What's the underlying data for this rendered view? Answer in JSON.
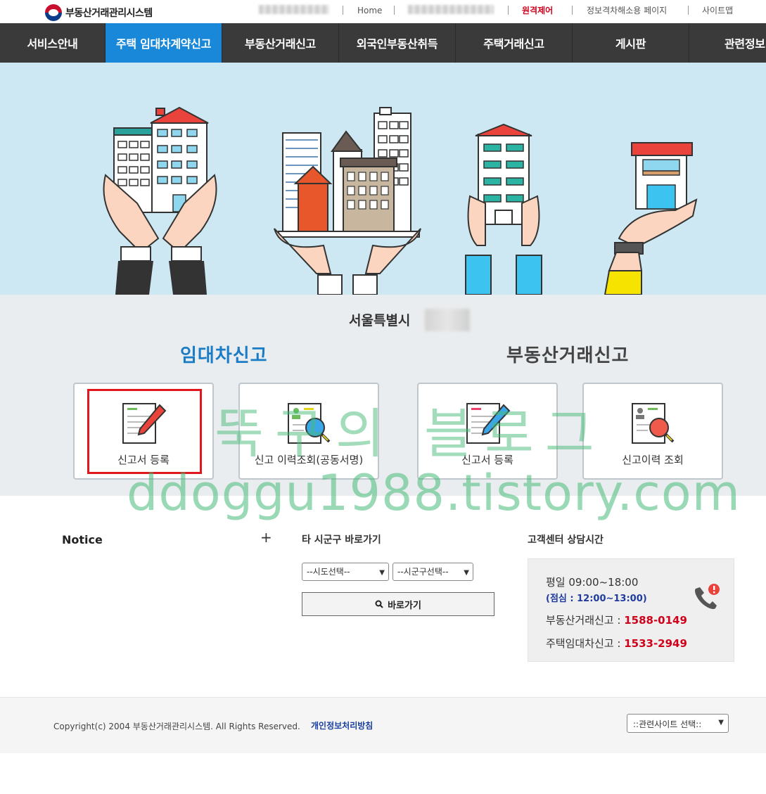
{
  "header": {
    "site_name": "부동산거래관리시스템",
    "home": "Home",
    "remote_control": "원격제어",
    "info_gap": "정보격차해소용 페이지",
    "sitemap": "사이트맵"
  },
  "nav": {
    "items": [
      {
        "label": "서비스안내"
      },
      {
        "label": "주택 임대차계약신고"
      },
      {
        "label": "부동산거래신고"
      },
      {
        "label": "외국인부동산취득"
      },
      {
        "label": "주택거래신고"
      },
      {
        "label": "게시판"
      },
      {
        "label": "관련정보"
      }
    ],
    "active_index": 1
  },
  "service": {
    "city": "서울특별시",
    "lease": {
      "title": "임대차신고",
      "register": "신고서 등록",
      "history": "신고 이력조회(공동서명)"
    },
    "trade": {
      "title": "부동산거래신고",
      "register": "신고서 등록",
      "history": "신고이력 조회"
    }
  },
  "watermark": {
    "line1": "뚝구의 블로그",
    "line2": "ddoggu1988.tistory.com"
  },
  "notice": {
    "title": "Notice",
    "more": "+"
  },
  "shortcut": {
    "title": "타 시군구 바로가기",
    "sido_placeholder": "--시도선택--",
    "sigungu_placeholder": "--시군구선택--",
    "go_label": "바로가기"
  },
  "customer_center": {
    "title": "고객센터 상담시간",
    "weekday": "평일 09:00~18:00",
    "lunch": "(점심 : 12:00~13:00)",
    "trade_label": "부동산거래신고 : ",
    "trade_number": "1588-0149",
    "lease_label": "주택임대차신고 : ",
    "lease_number": "1533-2949"
  },
  "footer": {
    "copyright": "Copyright(c) 2004 부동산거래관리시스템. All Rights Reserved.",
    "privacy": "개인정보처리방침",
    "related_sites": "::관련사이트 선택::"
  },
  "colors": {
    "nav_bg": "#3a3a3a",
    "nav_active": "#1a88d9",
    "accent_red": "#d0021b",
    "highlight_box": "#e0181d",
    "hero_bg": "#cde8f2"
  }
}
